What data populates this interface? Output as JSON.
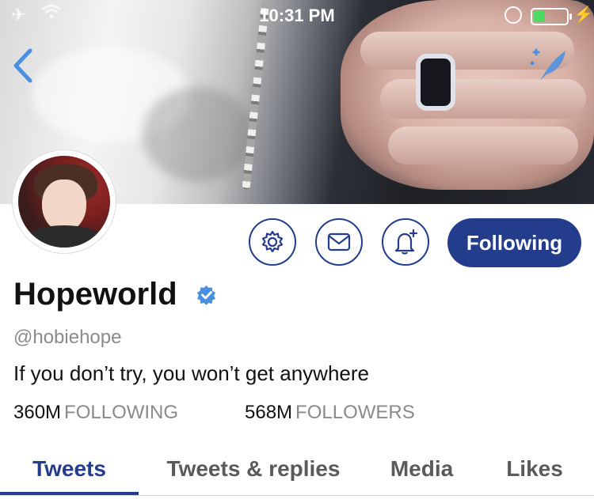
{
  "status_bar": {
    "time": "10:31 PM",
    "battery_level": 0.35
  },
  "profile": {
    "display_name": "Hopeworld",
    "verified": true,
    "handle": "@hobiehope",
    "bio": "If you don’t try, you won’t get anywhere",
    "following_count": "360M",
    "following_label": "FOLLOWING",
    "followers_count": "568M",
    "followers_label": "FOLLOWERS"
  },
  "actions": {
    "settings_icon": "gear-icon",
    "message_icon": "envelope-icon",
    "notify_icon": "bell-plus-icon",
    "follow_label": "Following"
  },
  "tabs": [
    {
      "label": "Tweets",
      "active": true
    },
    {
      "label": "Tweets & replies",
      "active": false
    },
    {
      "label": "Media",
      "active": false
    },
    {
      "label": "Likes",
      "active": false
    }
  ],
  "colors": {
    "accent": "#233d8c",
    "link_blue": "#4a90e2",
    "muted_text": "#8a8a8a",
    "battery_green": "#4cd964"
  }
}
